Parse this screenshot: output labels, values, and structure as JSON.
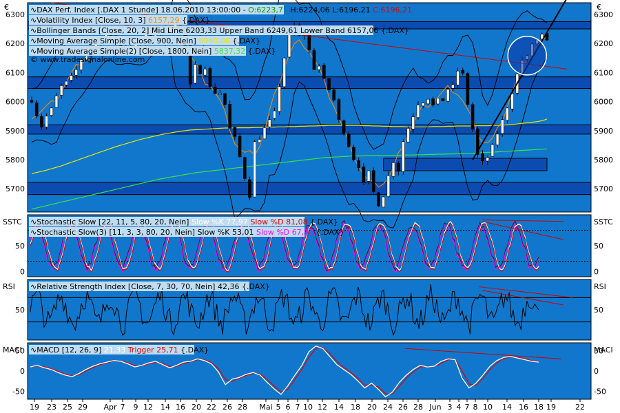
{
  "chart_data": [
    {
      "type": "line",
      "panel": "price",
      "currency_symbol": "€",
      "ylim": [
        5620,
        6340
      ],
      "yticks": [
        "5700",
        "5800",
        "5900",
        "6000",
        "6100",
        "6200",
        "6300"
      ],
      "legend": [
        {
          "text": "DAX Perf. Index [.DAX  1 Stunde] 18.06.2010 13:00:00 - ",
          "ohlc": [
            {
              "text": "O:6223,71",
              "color": "#00a000"
            },
            {
              "text": " H:6224,06 L:6196,21 ",
              "color": "#000000"
            },
            {
              "text": "C:6196,21",
              "color": "#e00000"
            }
          ]
        },
        {
          "text": "Volatility Index [Close, 10, 3] ",
          "value": "6157,29",
          "value_color": "#ff8c00",
          "suffix": " {.DAX}"
        },
        {
          "text": "Bollinger Bands [Close, 20, 2] Mid Line 6203,33 Upper Band 6249,61 Lower Band 6157,06 {.DAX}"
        },
        {
          "text": "Moving Average Simple [Close, 900, Nein] ",
          "value": "5940,06",
          "value_color": "#e8e800",
          "suffix": " {.DAX}"
        },
        {
          "text": "Moving Average Simple(2) [Close, 1800, Nein] ",
          "value": "5837,32",
          "value_color": "#40e040",
          "suffix": " {.DAX}"
        }
      ],
      "watermark": "© www.tradesignalonline.com",
      "series": {
        "close": [
          5998,
          5950,
          5912,
          5950,
          5978,
          6020,
          6055,
          6070,
          6090,
          6110,
          6145,
          6158,
          6183,
          6200,
          6215,
          6235,
          6228,
          6205,
          6190,
          6190,
          6168,
          6198,
          6200,
          6230,
          6228,
          6248,
          6238,
          6262,
          6249,
          6268,
          6255,
          6192,
          6060,
          6128,
          6095,
          6112,
          6052,
          6028,
          6028,
          5990,
          5908,
          5880,
          5810,
          5735,
          5670,
          5862,
          5870,
          5910,
          5938,
          5968,
          6052,
          6150,
          6230,
          6262,
          6228,
          6248,
          6178,
          6110,
          6122,
          6080,
          6040,
          6005,
          5938,
          5890,
          5845,
          5800,
          5772,
          5722,
          5762,
          5690,
          5640,
          5672,
          5745,
          5790,
          5760,
          5862,
          5908,
          5948,
          5988,
          5995,
          6008,
          5988,
          6012,
          6002,
          6042,
          6058,
          6105,
          6098,
          5990,
          5905,
          5818,
          5796,
          5808,
          5852,
          5888,
          5938,
          5978,
          6028,
          6095,
          6142,
          6158,
          6198,
          6212,
          6232,
          6212
        ],
        "ma900": [
          5752,
          5756,
          5760,
          5764,
          5769,
          5774,
          5779,
          5785,
          5791,
          5797,
          5803,
          5809,
          5815,
          5821,
          5827,
          5833,
          5839,
          5845,
          5850,
          5855,
          5860,
          5865,
          5870,
          5874,
          5878,
          5882,
          5886,
          5889,
          5892,
          5895,
          5898,
          5900,
          5902,
          5903,
          5904,
          5905,
          5906,
          5907,
          5908,
          5909,
          5909,
          5910,
          5910,
          5910,
          5910,
          5911,
          5911,
          5911,
          5912,
          5912,
          5913,
          5913,
          5914,
          5914,
          5915,
          5915,
          5916,
          5916,
          5917,
          5917,
          5918,
          5918,
          5918,
          5918,
          5918,
          5918,
          5918,
          5917,
          5917,
          5916,
          5916,
          5915,
          5915,
          5914,
          5914,
          5914,
          5913,
          5913,
          5913,
          5913,
          5913,
          5914,
          5914,
          5914,
          5915,
          5915,
          5916,
          5916,
          5916,
          5916,
          5917,
          5917,
          5917,
          5918,
          5918,
          5919,
          5920,
          5921,
          5923,
          5925,
          5927,
          5929,
          5931,
          5934,
          5940
        ],
        "ma1800": [
          5630,
          5634,
          5638,
          5642,
          5646,
          5650,
          5654,
          5658,
          5662,
          5666,
          5670,
          5674,
          5678,
          5682,
          5686,
          5690,
          5694,
          5698,
          5702,
          5706,
          5710,
          5714,
          5718,
          5722,
          5726,
          5730,
          5734,
          5737,
          5740,
          5743,
          5746,
          5749,
          5752,
          5755,
          5757,
          5759,
          5761,
          5763,
          5765,
          5767,
          5769,
          5771,
          5773,
          5775,
          5777,
          5779,
          5781,
          5783,
          5785,
          5787,
          5789,
          5791,
          5793,
          5795,
          5797,
          5799,
          5801,
          5803,
          5805,
          5807,
          5808,
          5809,
          5810,
          5811,
          5812,
          5813,
          5813,
          5813,
          5814,
          5814,
          5814,
          5814,
          5815,
          5815,
          5815,
          5816,
          5816,
          5816,
          5817,
          5817,
          5818,
          5818,
          5819,
          5819,
          5820,
          5820,
          5821,
          5821,
          5822,
          5822,
          5823,
          5824,
          5825,
          5826,
          5827,
          5828,
          5829,
          5830,
          5831,
          5832,
          5833,
          5834,
          5835,
          5836,
          5837
        ]
      },
      "zones": [
        {
          "from": 6250,
          "to": 6275
        },
        {
          "from": 6045,
          "to": 6085
        },
        {
          "from": 5888,
          "to": 5920
        },
        {
          "from": 5680,
          "to": 5722
        },
        {
          "from": 5762,
          "to": 5805,
          "x_from_index": 71,
          "x_to_index": 104
        }
      ],
      "trendlines": [
        {
          "color": "#d00000",
          "from": [
            4,
            6340
          ],
          "to": [
            108,
            6112
          ]
        },
        {
          "color": "#000000",
          "from": [
            89,
            5800
          ],
          "to": [
            108,
            6355
          ]
        }
      ],
      "highlight_circle_index": 100
    },
    {
      "type": "line",
      "panel": "stochastic",
      "label": "SSTC",
      "ylim": [
        -10,
        110
      ],
      "yticks": [
        "0",
        "50"
      ],
      "legend": [
        {
          "text": "Stochastic Slow [22, 11, 5, 80, 20, Nein] ",
          "parts": [
            {
              "text": "Slow %K 77,97",
              "color": "#ffffff"
            },
            {
              "text": " ",
              "color": "#000"
            },
            {
              "text": "Slow %D 81,08",
              "color": "#e00000"
            },
            {
              "text": " {.DAX}",
              "color": "#000"
            }
          ]
        },
        {
          "text": "Stochastic Slow(3) [11, 3, 3, 80, 20, Nein] Slow %K 53,01 ",
          "parts": [
            {
              "text": "Slow %D 67,97",
              "color": "#ff00ff"
            },
            {
              "text": " {.DAX}",
              "color": "#000"
            }
          ]
        }
      ],
      "levels": [
        80,
        20
      ]
    },
    {
      "type": "line",
      "panel": "rsi",
      "label": "RSI",
      "ylim": [
        0,
        100
      ],
      "yticks": [
        "50"
      ],
      "legend": [
        {
          "text": "Relative Strength Index [Close, 7, 30, 70, Nein] 42,36 {.DAX}"
        }
      ],
      "levels": [
        70,
        30
      ]
    },
    {
      "type": "line",
      "panel": "macd",
      "label": "MACI",
      "ylim": [
        -70,
        70
      ],
      "yticks": [
        "-50",
        "0",
        "50"
      ],
      "legend": [
        {
          "text": "MACD [12, 26, 9] ",
          "parts": [
            {
              "text": "21,33",
              "color": "#ffffff"
            },
            {
              "text": " ",
              "color": "#000"
            },
            {
              "text": "Trigger 25,71",
              "color": "#e00000"
            },
            {
              "text": " {.DAX}",
              "color": "#000"
            }
          ]
        }
      ],
      "macd": [
        10,
        14,
        8,
        4,
        -4,
        -10,
        -14,
        -6,
        4,
        12,
        18,
        22,
        26,
        24,
        18,
        10,
        14,
        20,
        24,
        16,
        8,
        14,
        22,
        24,
        30,
        26,
        18,
        -2,
        -34,
        -20,
        -16,
        -8,
        -4,
        -10,
        -28,
        -44,
        -58,
        -36,
        -10,
        14,
        48,
        62,
        56,
        36,
        16,
        4,
        -8,
        -24,
        -42,
        -30,
        -46,
        -64,
        -52,
        -28,
        -10,
        4,
        14,
        10,
        12,
        24,
        30,
        28,
        -18,
        -42,
        -30,
        -10,
        12,
        26,
        34,
        36,
        32,
        28,
        24,
        22
      ]
    }
  ],
  "x_axis": {
    "tick_labels": [
      "19",
      "23",
      "25",
      "29",
      "Apr",
      "7",
      "9",
      "12",
      "14",
      "16",
      "20",
      "22",
      "26",
      "28",
      "Mai",
      "5",
      "6",
      "7",
      "10",
      "12",
      "14",
      "18",
      "20",
      "24",
      "26",
      "28",
      "Jun",
      "3",
      "4",
      "7",
      "8",
      "10",
      "14",
      "16",
      "18",
      "19",
      "22"
    ]
  },
  "colors": {
    "background": "#1177cc",
    "candle_up": "#ffffff",
    "candle_down": "#000000",
    "bollinger": "#000000",
    "volatility": "#ff8c00",
    "ma900": "#e8e800",
    "ma1800": "#40e040",
    "stoch_k": "#ffffff",
    "stoch_d": "#e00000",
    "stoch2_k": "#202020",
    "stoch2_d": "#ff00ff",
    "rsi": "#000000",
    "macd": "#ffffff",
    "trigger": "#e00000",
    "zone_fill": "#0a2a9a",
    "legend_bg": "#c0dcf0"
  }
}
